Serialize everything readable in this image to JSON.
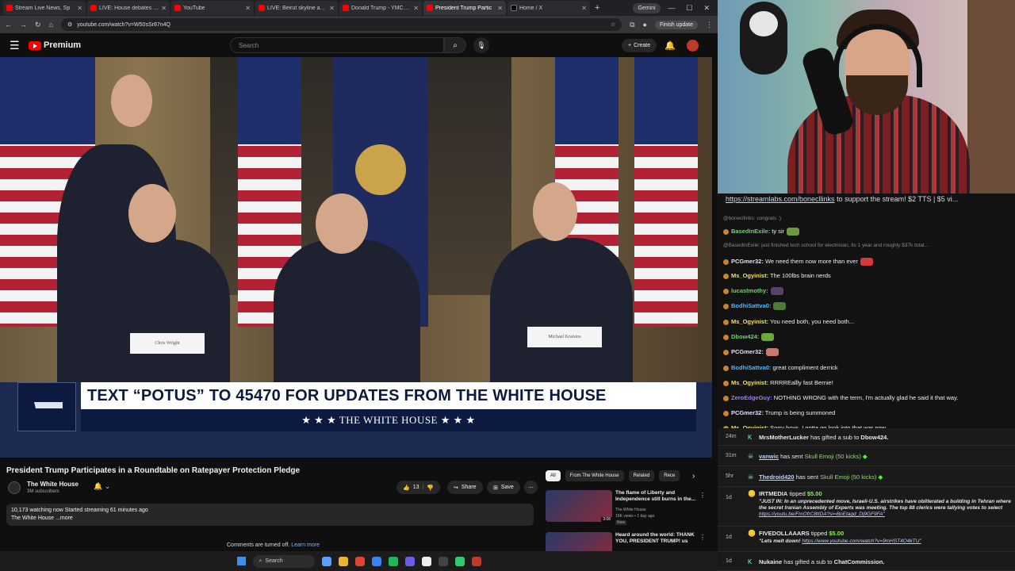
{
  "browser": {
    "tabs": [
      {
        "label": "Stream Live News, Sp"
      },
      {
        "label": "LIVE: House debates war"
      },
      {
        "label": "YouTube"
      },
      {
        "label": "LIVE: Beirut skyline as Isra"
      },
      {
        "label": "Donald Trump - YMCA (M"
      },
      {
        "label": "President Trump Partic"
      },
      {
        "label": "Home / X"
      }
    ],
    "gemini_label": "Gemini",
    "url": "youtube.com/watch?v=W50sSr87n4Q",
    "finish_update_label": "Finish update"
  },
  "youtube": {
    "logo_label": "Premium",
    "search_placeholder": "Search",
    "create_label": "Create",
    "banner": {
      "headline": "TEXT “POTUS” TO 45470 FOR UPDATES FROM THE WHITE HOUSE",
      "subline": "★ ★ ★  THE WHITE HOUSE  ★ ★ ★"
    },
    "placards": [
      "Chris Wright",
      "Michael Kratsios"
    ],
    "video_title": "President Trump Participates in a Roundtable on Ratepayer Protection Pledge",
    "channel_name": "The White House",
    "subscribers": "3M subscribers",
    "likes": "13",
    "share_label": "Share",
    "save_label": "Save",
    "watching_line": "10,173 watching now  Started streaming 61 minutes ago",
    "desc_line": "The White House ...more",
    "comments_off": "Comments are turned off.",
    "learn_more": "Learn more",
    "chips": [
      "All",
      "From The White House",
      "Related",
      "Rece"
    ],
    "recommendations": [
      {
        "title": "The flame of Liberty and Independence still burns in the...",
        "channel": "The White House",
        "meta": "16K views • 1 day ago",
        "tag": "New",
        "duration": "3:08"
      },
      {
        "title": "Heard around the world: THANK YOU, PRESIDENT TRUMP! us",
        "channel": "",
        "meta": "",
        "tag": "",
        "duration": ""
      }
    ]
  },
  "taskbar": {
    "search_label": "Search"
  },
  "chat": {
    "top_link": "https://streamlabs.com/bonecllinks",
    "top_rest": " to support the stream! $2 TTS | $5 vi...",
    "messages": [
      {
        "reply": "@bonecllinks: congrats :)"
      },
      {
        "user": "BasedInExile:",
        "text": " ty sir",
        "color": "#6fd16f",
        "emote": "#6a9a3a"
      },
      {
        "reply": "@BasedInExile: just finished tech school for electrician, its 1 year and roughly $37k total..."
      },
      {
        "user": "PCGmer32:",
        "text": " We need them now more than ever",
        "color": "#e0e0ff",
        "emote": "#d43a3a"
      },
      {
        "user": "Ms_Ogyinist:",
        "text": " The 100lbs brain nerds",
        "color": "#f0e060"
      },
      {
        "user": "lucastmothy:",
        "text": "",
        "color": "#6fd16f",
        "emote": "#554466"
      },
      {
        "user": "BodhiSattva0:",
        "text": "",
        "color": "#4fb8ff",
        "emote": "#4e7a3a"
      },
      {
        "user": "Ms_Ogyinist:",
        "text": " You need both, you need both...",
        "color": "#f0e060"
      },
      {
        "user": "Dbow424:",
        "text": "",
        "color": "#6fd16f",
        "emote": "#6aa83a"
      },
      {
        "user": "PCGmer32:",
        "text": "",
        "color": "#e0e0ff",
        "emote": "#c77a6a"
      },
      {
        "user": "BodhiSattva0:",
        "text": " great compliment derrick",
        "color": "#4fb8ff"
      },
      {
        "user": "Ms_Ogyinist:",
        "text": " RRRREallly fast Bernie!",
        "color": "#f0e060"
      },
      {
        "user": "ZeroEdgeGuy:",
        "text": " NOTHING WRONG with the term, I'm actually glad he said it that way.",
        "color": "#9f7aff"
      },
      {
        "user": "PCGmer32:",
        "text": " Trump is being summoned",
        "color": "#e0e0ff"
      },
      {
        "user": "Ms_Ogyinist:",
        "text": " Sorry boys, I gotta go look into that war now.",
        "color": "#f0e060"
      }
    ]
  },
  "events": [
    {
      "time": "24m",
      "name": "MrsMotherLucker",
      "text": " has gifted a sub to ",
      "target": "Dbow424."
    },
    {
      "time": "31m",
      "name": "vanwic",
      "text": " has sent ",
      "item": "Skull Emoji (50 kicks)"
    },
    {
      "time": "5hr",
      "name": "Thedroid420",
      "text": " has sent ",
      "item": "Skull Emoji (50 kicks)"
    },
    {
      "time": "1d",
      "name": "IRTMEDIA",
      "text": " tipped ",
      "amount": "$5.00",
      "note": "\"JUST IN: In an unprecedented move, Israeli-U.S. airstrikes have obliterated a building in Tehran where the secret Iranian Assembly of Experts was meeting. The top 88 clerics were tallying votes to select ",
      "note_link": "https://youtu.be/FmOfrC8tIDA?si=BoEtagd_Dj9GF9FA\""
    },
    {
      "time": "1d",
      "name": "FIVEDOLLAAARS",
      "text": " tipped ",
      "amount": "$5.00",
      "note": "\"Lets melt down! ",
      "note_link": "https://www.youtube.com/watch?v=9mHST4O4kTU\""
    },
    {
      "time": "1d",
      "name": "Nukaine",
      "text": " has gifted a sub to ",
      "target": "ChatCommission."
    }
  ]
}
